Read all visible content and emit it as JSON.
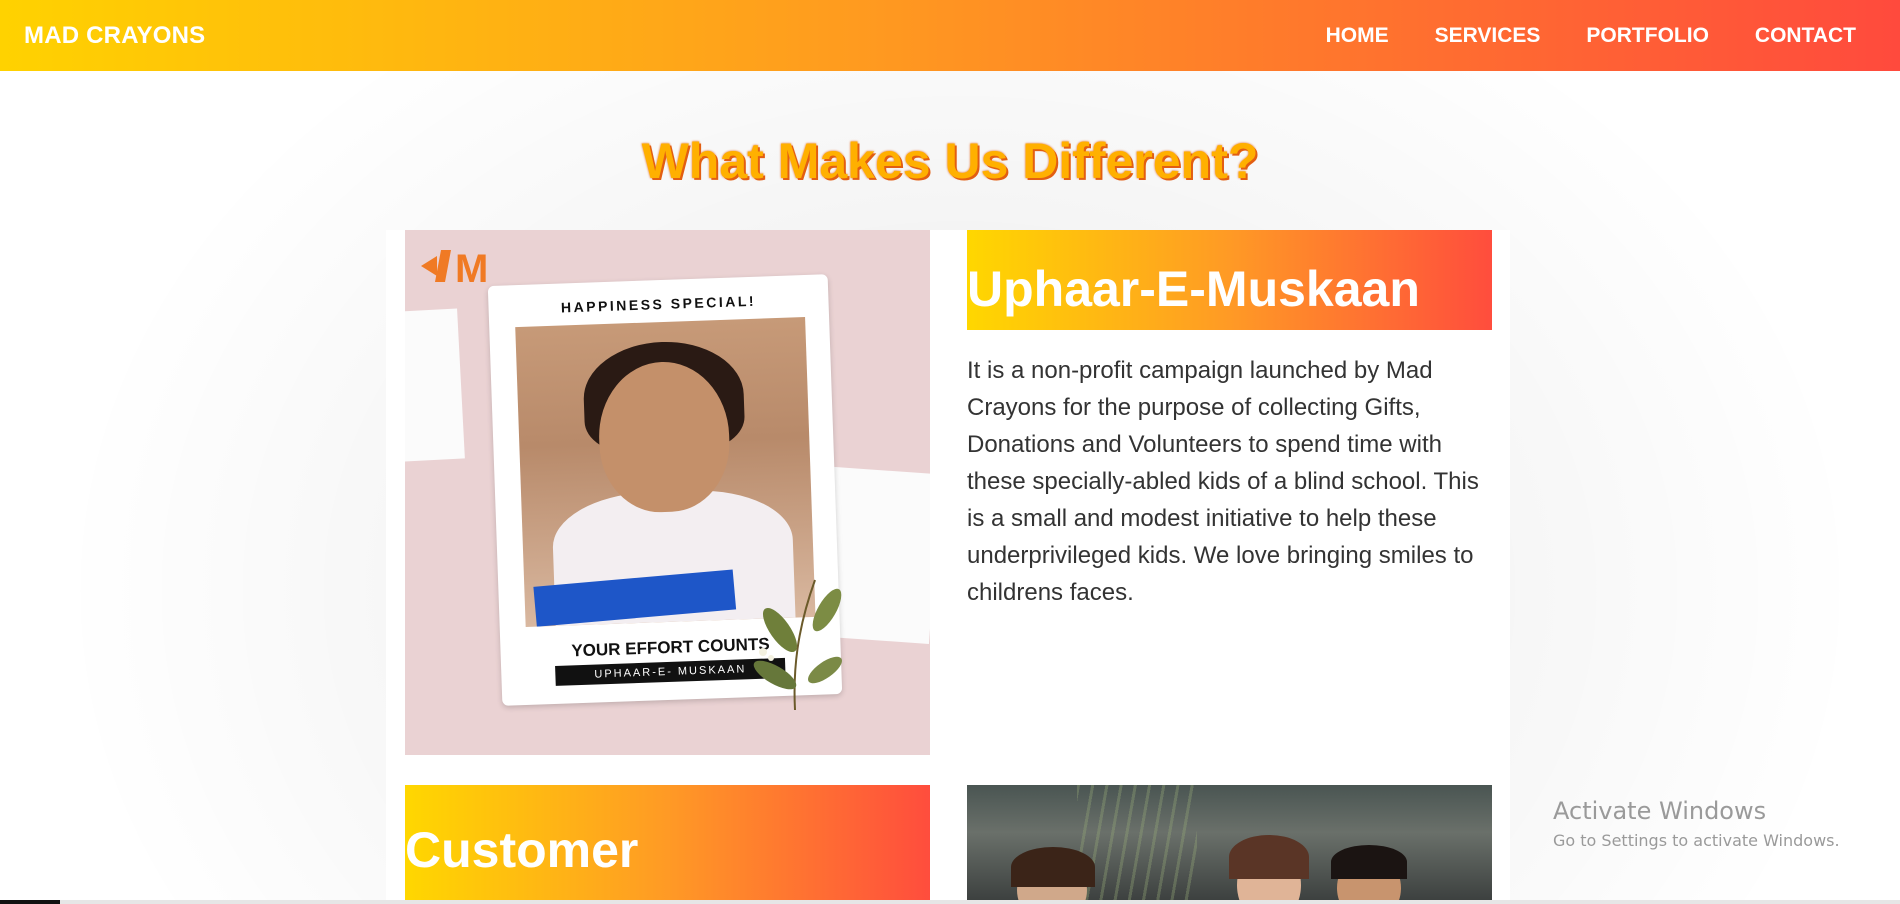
{
  "navbar": {
    "brand": "MAD CRAYONS",
    "links": [
      "HOME",
      "SERVICES",
      "PORTFOLIO",
      "CONTACT"
    ]
  },
  "section": {
    "title": "What Makes Us Different?"
  },
  "feature1": {
    "poster": {
      "logo": "M",
      "top_text": "HAPPINESS SPECIAL!",
      "bottom_text": "YOUR EFFORT COUNTS",
      "tag": "UPHAAR-E- MUSKAAN"
    },
    "title": "Uphaar-E-Muskaan",
    "description": "It is a non-profit campaign launched by Mad Crayons for the purpose of collecting Gifts, Donations and Volunteers to spend time with these specially-abled kids of a blind school. This is a small and modest initiative to help these underprivileged kids. We love bringing smiles to childrens faces."
  },
  "feature2": {
    "title": "Customer"
  },
  "watermark": {
    "title": "Activate Windows",
    "subtitle": "Go to Settings to activate Windows."
  },
  "colors": {
    "gradient_start": "#ffd200",
    "gradient_end": "#ff4a3d",
    "title_color": "#ffb000"
  }
}
